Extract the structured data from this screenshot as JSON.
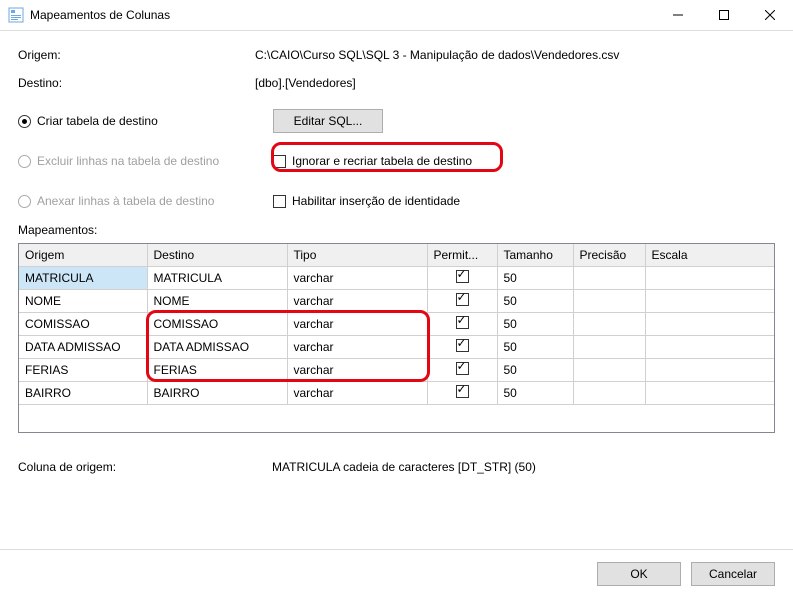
{
  "window": {
    "title": "Mapeamentos de Colunas"
  },
  "origin": {
    "label": "Origem:",
    "value": "C:\\CAIO\\Curso SQL\\SQL 3 - Manipulação de dados\\Vendedores.csv"
  },
  "destination": {
    "label": "Destino:",
    "value": "[dbo].[Vendedores]"
  },
  "options": {
    "create_table": {
      "label": "Criar tabela de destino",
      "checked": true
    },
    "edit_sql_button": "Editar SQL...",
    "delete_rows": {
      "label": "Excluir linhas na tabela de destino",
      "checked": false,
      "disabled": true
    },
    "drop_recreate": {
      "label": "Ignorar e recriar tabela de destino",
      "checked": false
    },
    "append_rows": {
      "label": "Anexar linhas à tabela de destino",
      "checked": false,
      "disabled": true
    },
    "identity_insert": {
      "label": "Habilitar inserção de identidade",
      "checked": false
    }
  },
  "mappings_label": "Mapeamentos:",
  "table": {
    "headers": {
      "origem": "Origem",
      "destino": "Destino",
      "tipo": "Tipo",
      "permit": "Permit...",
      "tamanho": "Tamanho",
      "precisao": "Precisão",
      "escala": "Escala"
    },
    "rows": [
      {
        "origem": "MATRICULA",
        "destino": "MATRICULA",
        "tipo": "varchar",
        "permit": true,
        "tamanho": "50",
        "precisao": "",
        "escala": "",
        "selected": true
      },
      {
        "origem": "NOME",
        "destino": "NOME",
        "tipo": "varchar",
        "permit": true,
        "tamanho": "50",
        "precisao": "",
        "escala": ""
      },
      {
        "origem": "COMISSAO",
        "destino": "COMISSAO",
        "tipo": "varchar",
        "permit": true,
        "tamanho": "50",
        "precisao": "",
        "escala": ""
      },
      {
        "origem": "DATA ADMISSAO",
        "destino": "DATA ADMISSAO",
        "tipo": "varchar",
        "permit": true,
        "tamanho": "50",
        "precisao": "",
        "escala": ""
      },
      {
        "origem": "FERIAS",
        "destino": "FERIAS",
        "tipo": "varchar",
        "permit": true,
        "tamanho": "50",
        "precisao": "",
        "escala": ""
      },
      {
        "origem": "BAIRRO",
        "destino": "BAIRRO",
        "tipo": "varchar",
        "permit": true,
        "tamanho": "50",
        "precisao": "",
        "escala": ""
      }
    ]
  },
  "source_column": {
    "label": "Coluna de origem:",
    "value": "MATRICULA cadeia de caracteres [DT_STR] (50)"
  },
  "buttons": {
    "ok": "OK",
    "cancel": "Cancelar"
  }
}
